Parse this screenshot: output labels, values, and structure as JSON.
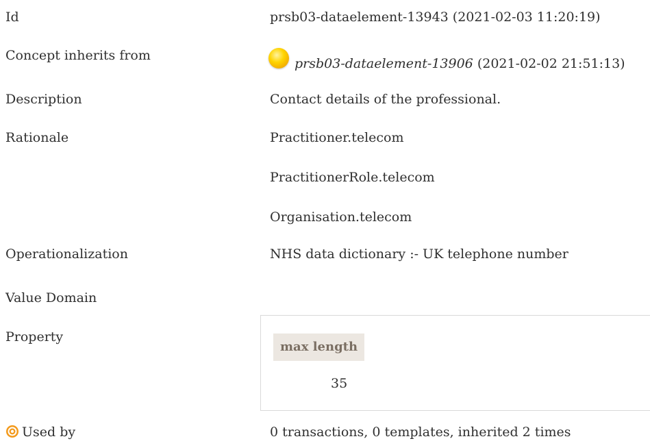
{
  "rows": {
    "id": {
      "label": "Id",
      "value": "prsb03-dataelement-13943 (2021-02-03 11:20:19)"
    },
    "inherits": {
      "label": "Concept inherits from",
      "link": "prsb03-dataelement-13906",
      "timestamp": "(2021-02-02 21:51:13)"
    },
    "description": {
      "label": "Description",
      "value": "Contact details of the professional."
    },
    "rationale": {
      "label": "Rationale",
      "lines": [
        "Practitioner.telecom",
        "PractitionerRole.telecom",
        "Organisation.telecom"
      ]
    },
    "operationalization": {
      "label": "Operationalization",
      "value": "NHS data dictionary :- UK telephone number"
    },
    "value_domain": {
      "label": "Value Domain"
    },
    "property": {
      "label": "Property",
      "header": "max length",
      "value": "35"
    },
    "used_by": {
      "label": "Used by",
      "value": "0 transactions, 0 templates, inherited 2 times"
    }
  },
  "colors": {
    "text": "#2f2f2f",
    "property_header_bg": "#ece7e1",
    "property_header_text": "#7a6e62",
    "box_border": "#d9d9d9",
    "orb": "#ffd400",
    "used_by_icon": "#f08c00"
  },
  "icons": {
    "inherit": "yellow-orb-icon",
    "used_by": "target-icon"
  }
}
